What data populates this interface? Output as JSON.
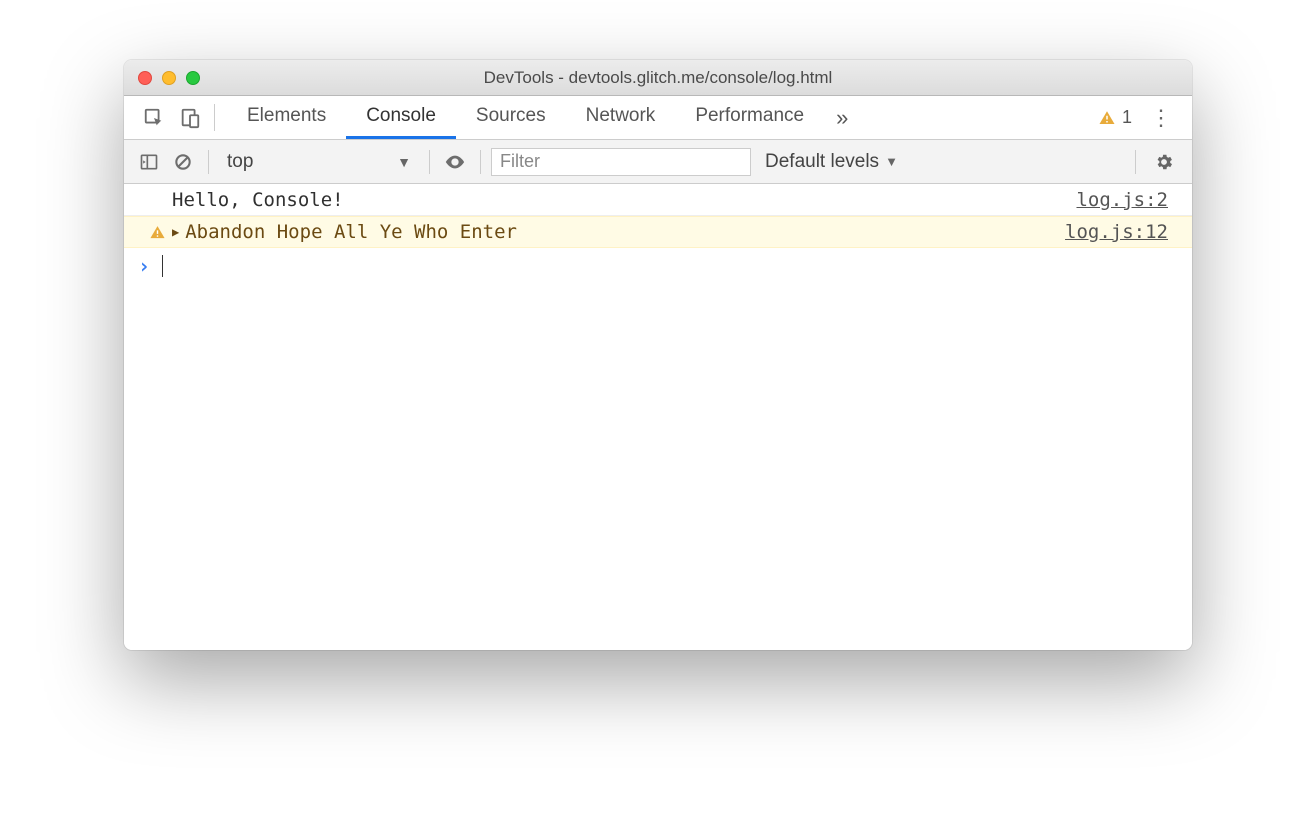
{
  "window": {
    "title": "DevTools - devtools.glitch.me/console/log.html"
  },
  "tabs": {
    "items": [
      "Elements",
      "Console",
      "Sources",
      "Network",
      "Performance"
    ],
    "active_index": 1,
    "warning_count": "1"
  },
  "toolbar": {
    "context": "top",
    "filter_placeholder": "Filter",
    "levels_label": "Default levels"
  },
  "console": {
    "rows": [
      {
        "type": "log",
        "message": "Hello, Console!",
        "source": "log.js:2"
      },
      {
        "type": "warn",
        "message": "Abandon Hope All Ye Who Enter",
        "source": "log.js:12"
      }
    ],
    "prompt": "›"
  }
}
